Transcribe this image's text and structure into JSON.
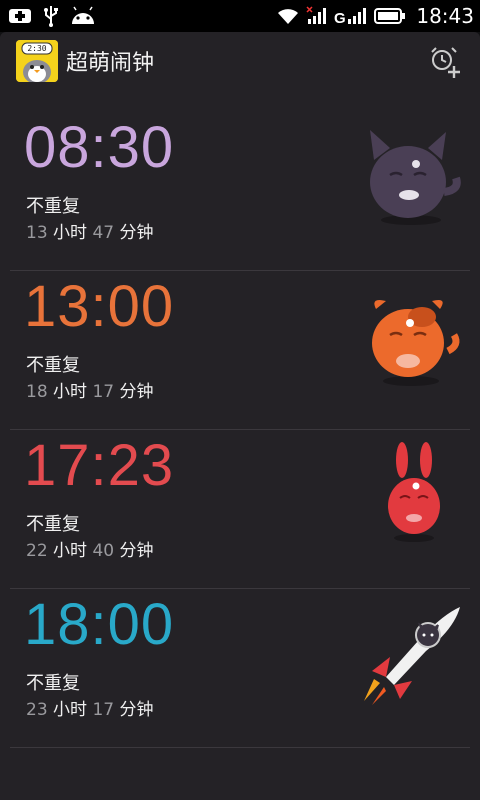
{
  "status_bar": {
    "time": "18:43",
    "icons": [
      "usb-debug-icon",
      "usb-icon",
      "android-icon",
      "wifi-icon",
      "signal-icon",
      "signal-g-icon",
      "battery-icon"
    ]
  },
  "app": {
    "title": "超萌闹钟",
    "icon_text": "2:30"
  },
  "alarms": [
    {
      "time": "08:30",
      "color": "#c9a6dd",
      "repeat": "不重复",
      "hours": "13",
      "hours_unit": "小时",
      "minutes": "47",
      "minutes_unit": "分钟",
      "mascot": "purple-cat"
    },
    {
      "time": "13:00",
      "color": "#e8733a",
      "repeat": "不重复",
      "hours": "18",
      "hours_unit": "小时",
      "minutes": "17",
      "minutes_unit": "分钟",
      "mascot": "orange-dog"
    },
    {
      "time": "17:23",
      "color": "#e34b4f",
      "repeat": "不重复",
      "hours": "22",
      "hours_unit": "小时",
      "minutes": "40",
      "minutes_unit": "分钟",
      "mascot": "red-rabbit"
    },
    {
      "time": "18:00",
      "color": "#29a9c9",
      "repeat": "不重复",
      "hours": "23",
      "hours_unit": "小时",
      "minutes": "17",
      "minutes_unit": "分钟",
      "mascot": "rocket"
    }
  ]
}
